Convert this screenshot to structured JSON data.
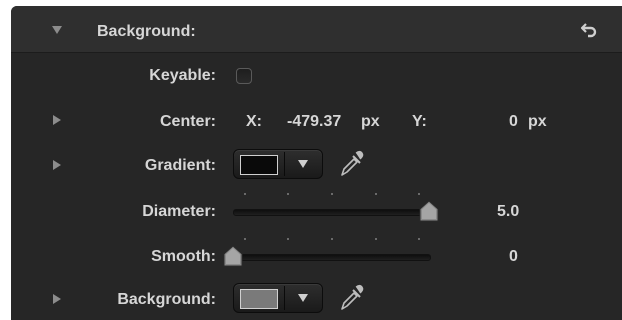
{
  "section": {
    "title": "Background:",
    "reset_icon": "reset-arrow-icon",
    "disclosure_icon": "disclosure-expanded-icon"
  },
  "rows": {
    "keyable": {
      "label": "Keyable:",
      "checked": false
    },
    "center": {
      "label": "Center:",
      "x_label": "X:",
      "x_value": "-479.37",
      "x_unit": "px",
      "y_label": "Y:",
      "y_value": "0",
      "y_unit": "px"
    },
    "gradient": {
      "label": "Gradient:",
      "swatch_color": "#0a0a0a"
    },
    "diameter": {
      "label": "Diameter:",
      "value": "5.0",
      "slider_fraction": 1.0
    },
    "smooth": {
      "label": "Smooth:",
      "value": "0",
      "slider_fraction": 0.0
    },
    "background": {
      "label": "Background:",
      "swatch_color": "#7a7a7a"
    }
  },
  "colors": {
    "panel_bg": "#262626",
    "header_bg": "#2f2f2f",
    "text": "#d6d6d6"
  }
}
